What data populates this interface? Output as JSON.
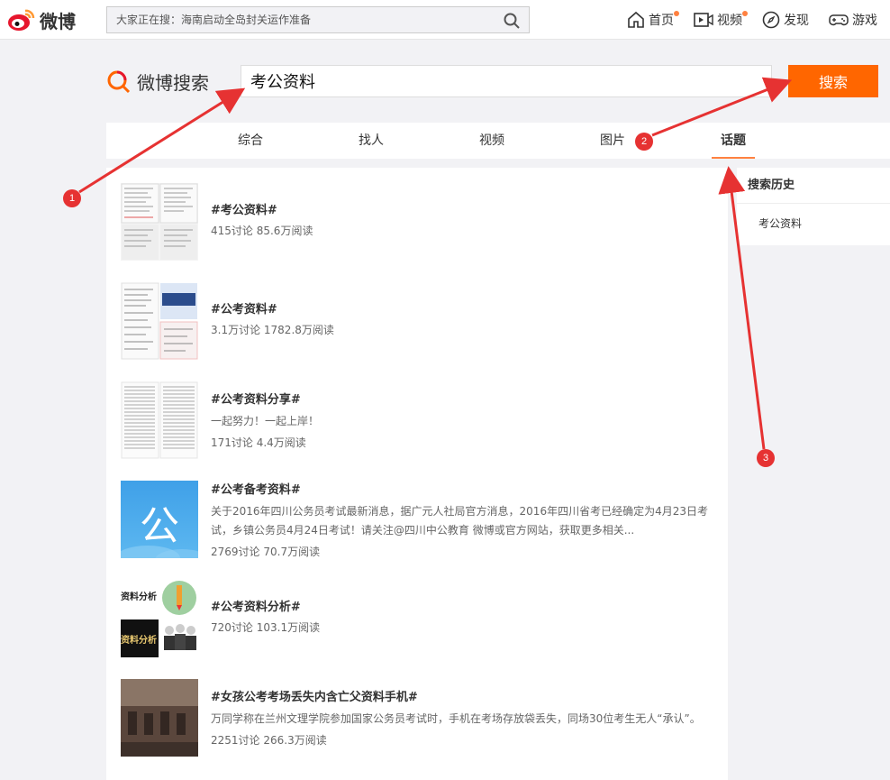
{
  "topbar": {
    "logo_text": "微博",
    "search_placeholder": "大家正在搜：海南启动全岛封关运作准备",
    "nav": [
      {
        "label": "首页",
        "icon": "home-icon",
        "dot": true
      },
      {
        "label": "视频",
        "icon": "video-icon",
        "dot": true
      },
      {
        "label": "发现",
        "icon": "compass-icon",
        "dot": false
      },
      {
        "label": "游戏",
        "icon": "gamepad-icon",
        "dot": false
      }
    ]
  },
  "search": {
    "logo_text": "微博搜索",
    "query": "考公资料",
    "button_label": "搜索"
  },
  "tabs": [
    {
      "label": "综合",
      "active": false
    },
    {
      "label": "找人",
      "active": false
    },
    {
      "label": "视频",
      "active": false
    },
    {
      "label": "图片",
      "active": false
    },
    {
      "label": "话题",
      "active": true
    }
  ],
  "results": [
    {
      "title": "#考公资料#",
      "desc": "",
      "stats": "415讨论 85.6万阅读"
    },
    {
      "title": "#公考资料#",
      "desc": "",
      "stats": "3.1万讨论 1782.8万阅读"
    },
    {
      "title": "#公考资料分享#",
      "desc": "一起努力！一起上岸！",
      "stats": "171讨论 4.4万阅读"
    },
    {
      "title": "#公考备考资料#",
      "desc": "关于2016年四川公务员考试最新消息，据广元人社局官方消息，2016年四川省考已经确定为4月23日考试，乡镇公务员4月24日考试！请关注@四川中公教育 微博或官方网站，获取更多相关...",
      "stats": "2769讨论 70.7万阅读",
      "thumb_char": "公"
    },
    {
      "title": "#公考资料分析#",
      "desc": "",
      "stats": "720讨论 103.1万阅读",
      "thumb_text": "资料分析",
      "thumb_text2": "资料分析"
    },
    {
      "title": "#女孩公考考场丢失内含亡父资料手机#",
      "desc": "万同学称在兰州文理学院参加国家公务员考试时，手机在考场存放袋丢失，同场30位考生无人“承认”。",
      "stats": "2251讨论 266.3万阅读"
    }
  ],
  "sidebar": {
    "title": "搜索历史",
    "items": [
      "考公资料"
    ]
  },
  "annotations": [
    "1",
    "2",
    "3"
  ],
  "colors": {
    "accent": "#ff6600",
    "tab_underline": "#ff8140",
    "annotation": "#e63232",
    "weibo_red": "#e6162d",
    "weibo_orange": "#ff9933"
  }
}
